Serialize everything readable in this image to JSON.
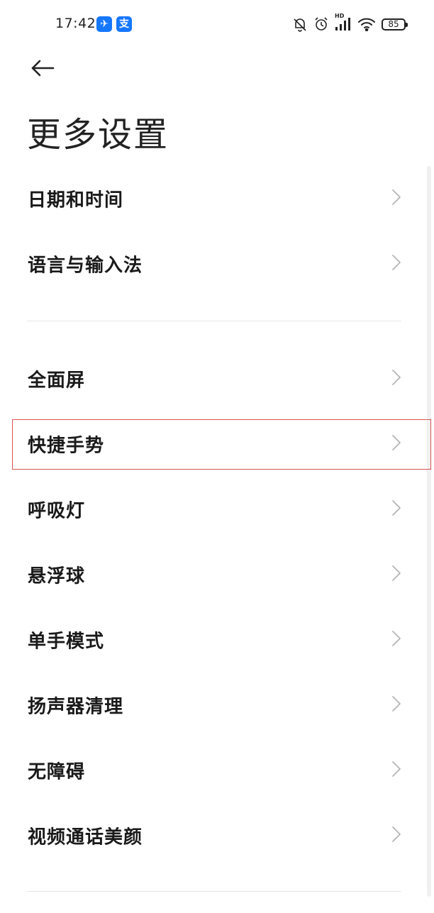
{
  "status_bar": {
    "time": "17:42",
    "app_badges": [
      {
        "icon": "lark-app-icon",
        "glyph": "✈"
      },
      {
        "icon": "alipay-app-icon",
        "glyph": "支"
      }
    ],
    "icons": [
      "bell-muted-icon",
      "alarm-icon",
      "hd-signal-icon",
      "wifi-icon"
    ],
    "signal_label": "HD",
    "battery": "85"
  },
  "header": {
    "back_icon": "arrow-left-icon",
    "title": "更多设置"
  },
  "groups": [
    {
      "items": [
        {
          "label": "日期和时间"
        },
        {
          "label": "语言与输入法"
        }
      ]
    },
    {
      "items": [
        {
          "label": "全面屏"
        },
        {
          "label": "快捷手势",
          "highlighted": true
        },
        {
          "label": "呼吸灯"
        },
        {
          "label": "悬浮球"
        },
        {
          "label": "单手模式"
        },
        {
          "label": "扬声器清理"
        },
        {
          "label": "无障碍"
        },
        {
          "label": "视频通话美颜"
        }
      ]
    }
  ],
  "colors": {
    "highlight": "#d9534f",
    "chevron": "#b5b5b5",
    "badge": "#1677ff"
  }
}
